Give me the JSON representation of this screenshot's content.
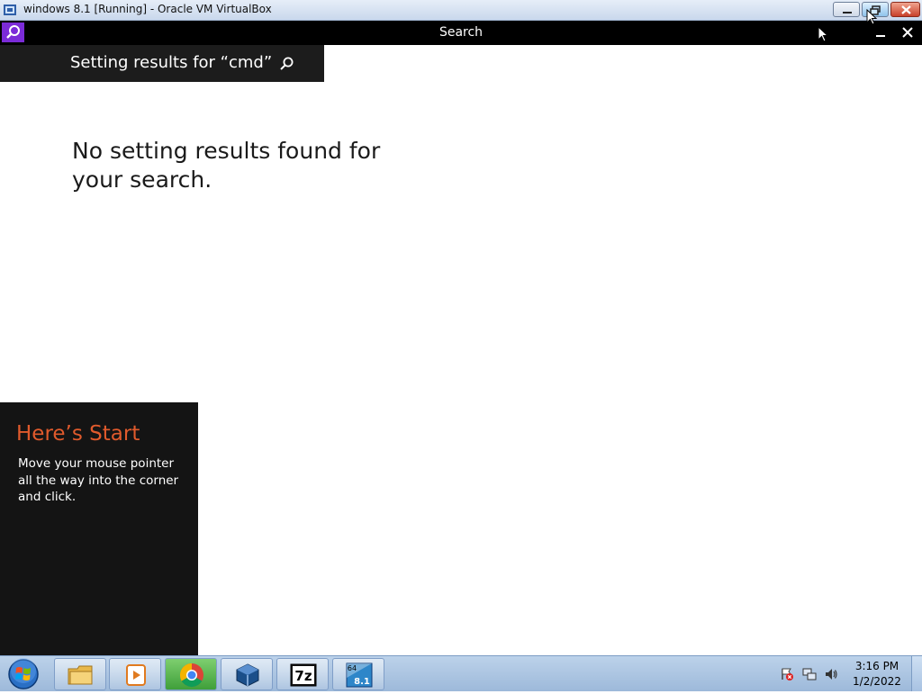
{
  "host_window": {
    "title": "windows 8.1 [Running] - Oracle VM VirtualBox",
    "icons": [
      "virtualbox-icon",
      "minimize-icon",
      "restore-icon",
      "close-icon"
    ]
  },
  "search_app": {
    "title": "Search",
    "accent_color": "#7b2bd8",
    "results_header": "Setting results for “cmd”",
    "no_results_message": "No setting results found for your search."
  },
  "start_tip": {
    "title": "Here’s Start",
    "body": "Move your mouse pointer all the way into the corner and click.",
    "title_color": "#e05a2c"
  },
  "taskbar": {
    "pinned_items": [
      {
        "name": "windows-explorer",
        "icon": "folder-icon"
      },
      {
        "name": "media-player",
        "icon": "media-player-icon"
      },
      {
        "name": "google-chrome",
        "icon": "chrome-icon"
      },
      {
        "name": "virtualbox",
        "icon": "virtualbox-icon"
      },
      {
        "name": "7-zip",
        "icon": "7zip-icon",
        "label": "7z"
      },
      {
        "name": "windows-8-1-vm",
        "icon": "win81-iso-icon",
        "label_top": "64",
        "label_bottom": "8.1"
      }
    ],
    "clock": {
      "time": "3:16 PM",
      "date": "1/2/2022"
    },
    "tray_icons": [
      "action-center-icon",
      "network-icon",
      "volume-icon"
    ]
  }
}
